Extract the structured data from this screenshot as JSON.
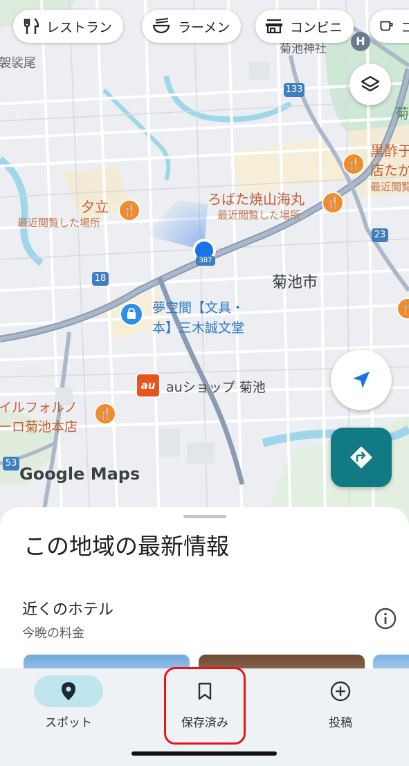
{
  "chips": [
    {
      "label": "レストラン",
      "icon": "fork-knife-icon"
    },
    {
      "label": "ラーメン",
      "icon": "ramen-bowl-icon"
    },
    {
      "label": "コンビニ",
      "icon": "store-icon"
    },
    {
      "label": "コ",
      "icon": "coffee-cup-icon"
    }
  ],
  "map": {
    "place_labels": {
      "kikuchi_shrine": "菊池神社",
      "ura_kanno": "袈裟尾",
      "kikuchi_right": "菊",
      "kuro_1": "黒酢于",
      "kuro_2": "店たか",
      "kuro_recent": "最近閲覧した場所",
      "robata": "ろばた焼山海丸",
      "robata_recent": "最近閲覧した場所",
      "yudachi": "夕立",
      "yudachi_recent": "最近閲覧した場所",
      "city": "菊池市",
      "yumekukan_1": "夢空間【文具・",
      "yumekukan_2": "本】三木誠文堂",
      "au_shop": "auショップ 菊池",
      "il_1": "イルフォルノ",
      "il_2": "ーロ菊池本店",
      "au_logo": "au"
    },
    "road_badges": {
      "r133": "133",
      "r23": "23",
      "r18": "18",
      "r53": "53",
      "r387": "387"
    },
    "attribution": "Google Maps",
    "accent_color": "#1a73e8",
    "restaurant_pin_color": "#f08c2c"
  },
  "buttons": {
    "layers_icon": "layers-icon",
    "location_icon": "navigation-arrow-icon",
    "directions_icon": "directions-icon"
  },
  "sheet": {
    "title": "この地域の最新情報",
    "hotel_title": "近くのホテル",
    "hotel_sub": "今晩の料金"
  },
  "nav": {
    "items": [
      {
        "label": "スポット",
        "icon": "place-pin-icon",
        "active": true
      },
      {
        "label": "保存済み",
        "icon": "bookmark-icon",
        "active": false
      },
      {
        "label": "投稿",
        "icon": "add-circle-icon",
        "active": false
      }
    ]
  }
}
